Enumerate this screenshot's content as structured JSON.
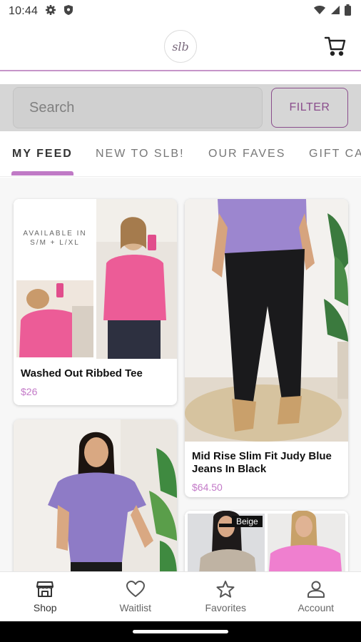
{
  "status_bar": {
    "time": "10:44",
    "icons": [
      "gear-icon",
      "shield-icon",
      "wifi-icon",
      "signal-icon",
      "battery-icon"
    ]
  },
  "header": {
    "logo_text": "slb",
    "cart_icon": "cart-icon"
  },
  "search": {
    "placeholder": "Search",
    "filter_label": "FILTER"
  },
  "tabs": [
    {
      "label": "MY FEED",
      "active": true
    },
    {
      "label": "NEW TO SLB!",
      "active": false
    },
    {
      "label": "OUR FAVES",
      "active": false
    },
    {
      "label": "GIFT CA",
      "active": false
    }
  ],
  "products": [
    {
      "name": "Washed Out Ribbed Tee",
      "price": "$26",
      "image_text": "AVAILABLE IN\nS/M + L/XL"
    },
    {
      "name": "Mid Rise Slim Fit Judy Blue Jeans In Black",
      "price": "$64.50"
    },
    {
      "name": "",
      "price": ""
    },
    {
      "name": "",
      "price": "",
      "badge": "Beige"
    }
  ],
  "bottom_nav": [
    {
      "label": "Shop",
      "icon": "shop-icon",
      "active": true
    },
    {
      "label": "Waitlist",
      "icon": "heart-icon",
      "active": false
    },
    {
      "label": "Favorites",
      "icon": "star-icon",
      "active": false
    },
    {
      "label": "Account",
      "icon": "account-icon",
      "active": false
    }
  ],
  "colors": {
    "accent": "#c07ac6",
    "filter": "#8a4d8c",
    "price": "#c37ac8"
  }
}
